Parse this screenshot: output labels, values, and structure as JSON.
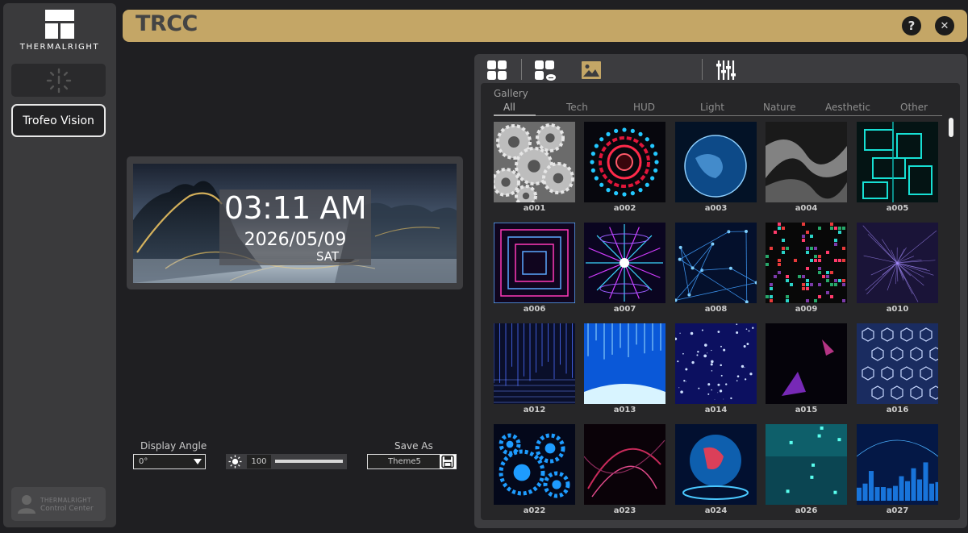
{
  "app": {
    "brand": "THERMALRIGHT",
    "title": "TRCC",
    "help_label": "?",
    "close_label": "✕"
  },
  "sidebar": {
    "device_button": "Trofeo Vision",
    "footer_line1": "THERMALRIGHT",
    "footer_line2": "Control Center"
  },
  "preview": {
    "time": "03:11 AM",
    "date": "2026/05/09",
    "day": "SAT"
  },
  "controls": {
    "display_angle_label": "Display Angle",
    "display_angle_value": "0°",
    "brightness_value": "100",
    "brightness_level": 1.0,
    "save_as_label": "Save As",
    "save_as_value": "Theme5"
  },
  "gallery": {
    "label": "Gallery",
    "tabs": [
      "All",
      "Tech",
      "HUD",
      "Light",
      "Nature",
      "Aesthetic",
      "Other"
    ],
    "active_tab": "All",
    "items": [
      {
        "name": "a001",
        "style": "gears"
      },
      {
        "name": "a002",
        "style": "ring"
      },
      {
        "name": "a003",
        "style": "globe"
      },
      {
        "name": "a004",
        "style": "silk"
      },
      {
        "name": "a005",
        "style": "circuit"
      },
      {
        "name": "a006",
        "style": "tunnel"
      },
      {
        "name": "a007",
        "style": "burst"
      },
      {
        "name": "a008",
        "style": "network"
      },
      {
        "name": "a009",
        "style": "pixels"
      },
      {
        "name": "a010",
        "style": "space"
      },
      {
        "name": "a012",
        "style": "grid"
      },
      {
        "name": "a013",
        "style": "earthblue"
      },
      {
        "name": "a014",
        "style": "stars"
      },
      {
        "name": "a015",
        "style": "dark"
      },
      {
        "name": "a016",
        "style": "hex"
      },
      {
        "name": "a022",
        "style": "bluegears"
      },
      {
        "name": "a023",
        "style": "arcs"
      },
      {
        "name": "a024",
        "style": "holo"
      },
      {
        "name": "a026",
        "style": "teal"
      },
      {
        "name": "a027",
        "style": "city"
      }
    ]
  },
  "colors": {
    "header": "#c4a666",
    "accent_icon": "#c4a666",
    "panel": "#3c3c3f",
    "sidebar": "#3a3a3c"
  },
  "icons": {
    "themes": "grid-icon",
    "cloud_themes": "grid-cloud-icon",
    "gallery": "image-icon",
    "settings": "sliders-icon"
  }
}
